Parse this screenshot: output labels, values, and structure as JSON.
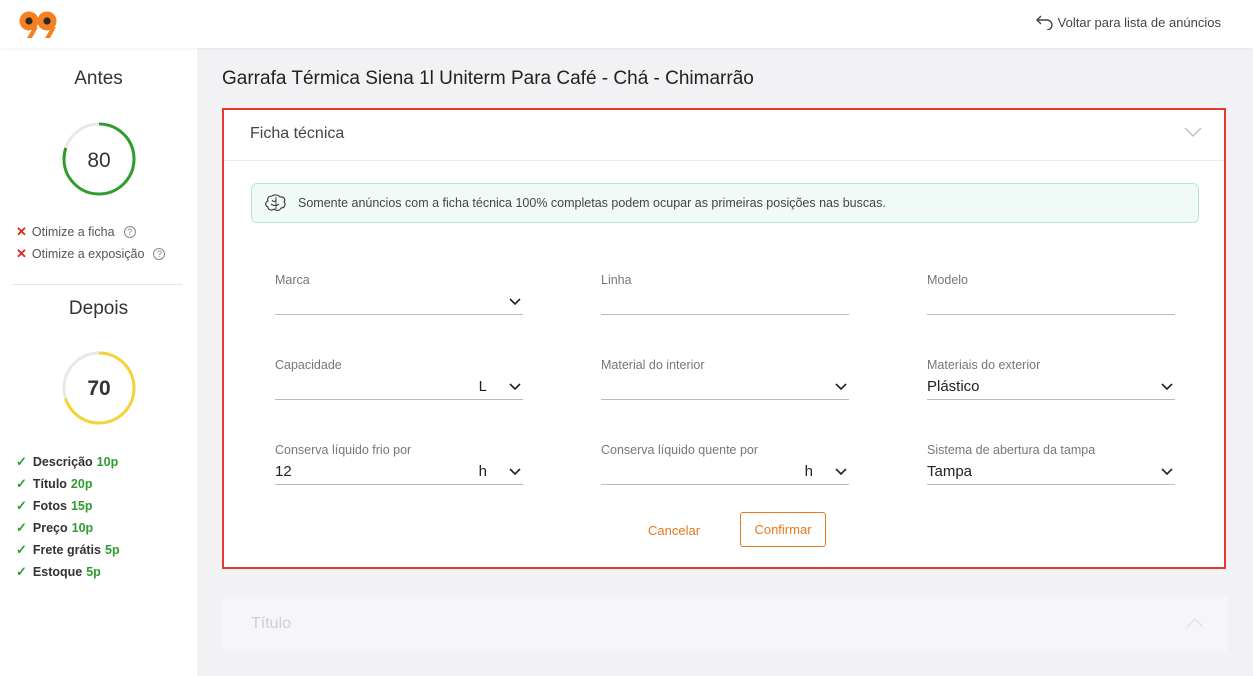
{
  "header": {
    "back_label": "Voltar para lista de anúncios",
    "brand_color": "#f5801f"
  },
  "sidebar": {
    "before_title": "Antes",
    "before_score": 80,
    "before_score_max": 100,
    "issues": [
      {
        "label": "Otimize a ficha"
      },
      {
        "label": "Otimize a exposição"
      }
    ],
    "after_title": "Depois",
    "after_score": 70,
    "after_score_max": 100,
    "checks": [
      {
        "label": "Descrição",
        "points": "10p"
      },
      {
        "label": "Título",
        "points": "20p"
      },
      {
        "label": "Fotos",
        "points": "15p"
      },
      {
        "label": "Preço",
        "points": "10p"
      },
      {
        "label": "Frete grátis",
        "points": "5p"
      },
      {
        "label": "Estoque",
        "points": "5p"
      }
    ]
  },
  "main": {
    "product_title": "Garrafa Térmica Siena 1l Uniterm Para Café - Chá - Chimarrão",
    "sheet": {
      "title": "Ficha técnica",
      "info": "Somente anúncios com a ficha técnica 100% completas podem ocupar as primeiras posições nas buscas.",
      "fields": [
        {
          "label": "Marca",
          "value": "",
          "unit": "",
          "dropdown": true
        },
        {
          "label": "Linha",
          "value": "",
          "unit": "",
          "dropdown": false
        },
        {
          "label": "Modelo",
          "value": "",
          "unit": "",
          "dropdown": false
        },
        {
          "label": "Capacidade",
          "value": "",
          "unit": "L",
          "dropdown": true
        },
        {
          "label": "Material do interior",
          "value": "",
          "unit": "",
          "dropdown": true
        },
        {
          "label": "Materiais do exterior",
          "value": "Plástico",
          "unit": "",
          "dropdown": true
        },
        {
          "label": "Conserva líquido frio por",
          "value": "12",
          "unit": "h",
          "dropdown": true
        },
        {
          "label": "Conserva líquido quente por",
          "value": "",
          "unit": "h",
          "dropdown": true
        },
        {
          "label": "Sistema de abertura da tampa",
          "value": "Tampa",
          "unit": "",
          "dropdown": true
        }
      ],
      "cancel_label": "Cancelar",
      "confirm_label": "Confirmar"
    },
    "title_section": {
      "title": "Título"
    }
  }
}
